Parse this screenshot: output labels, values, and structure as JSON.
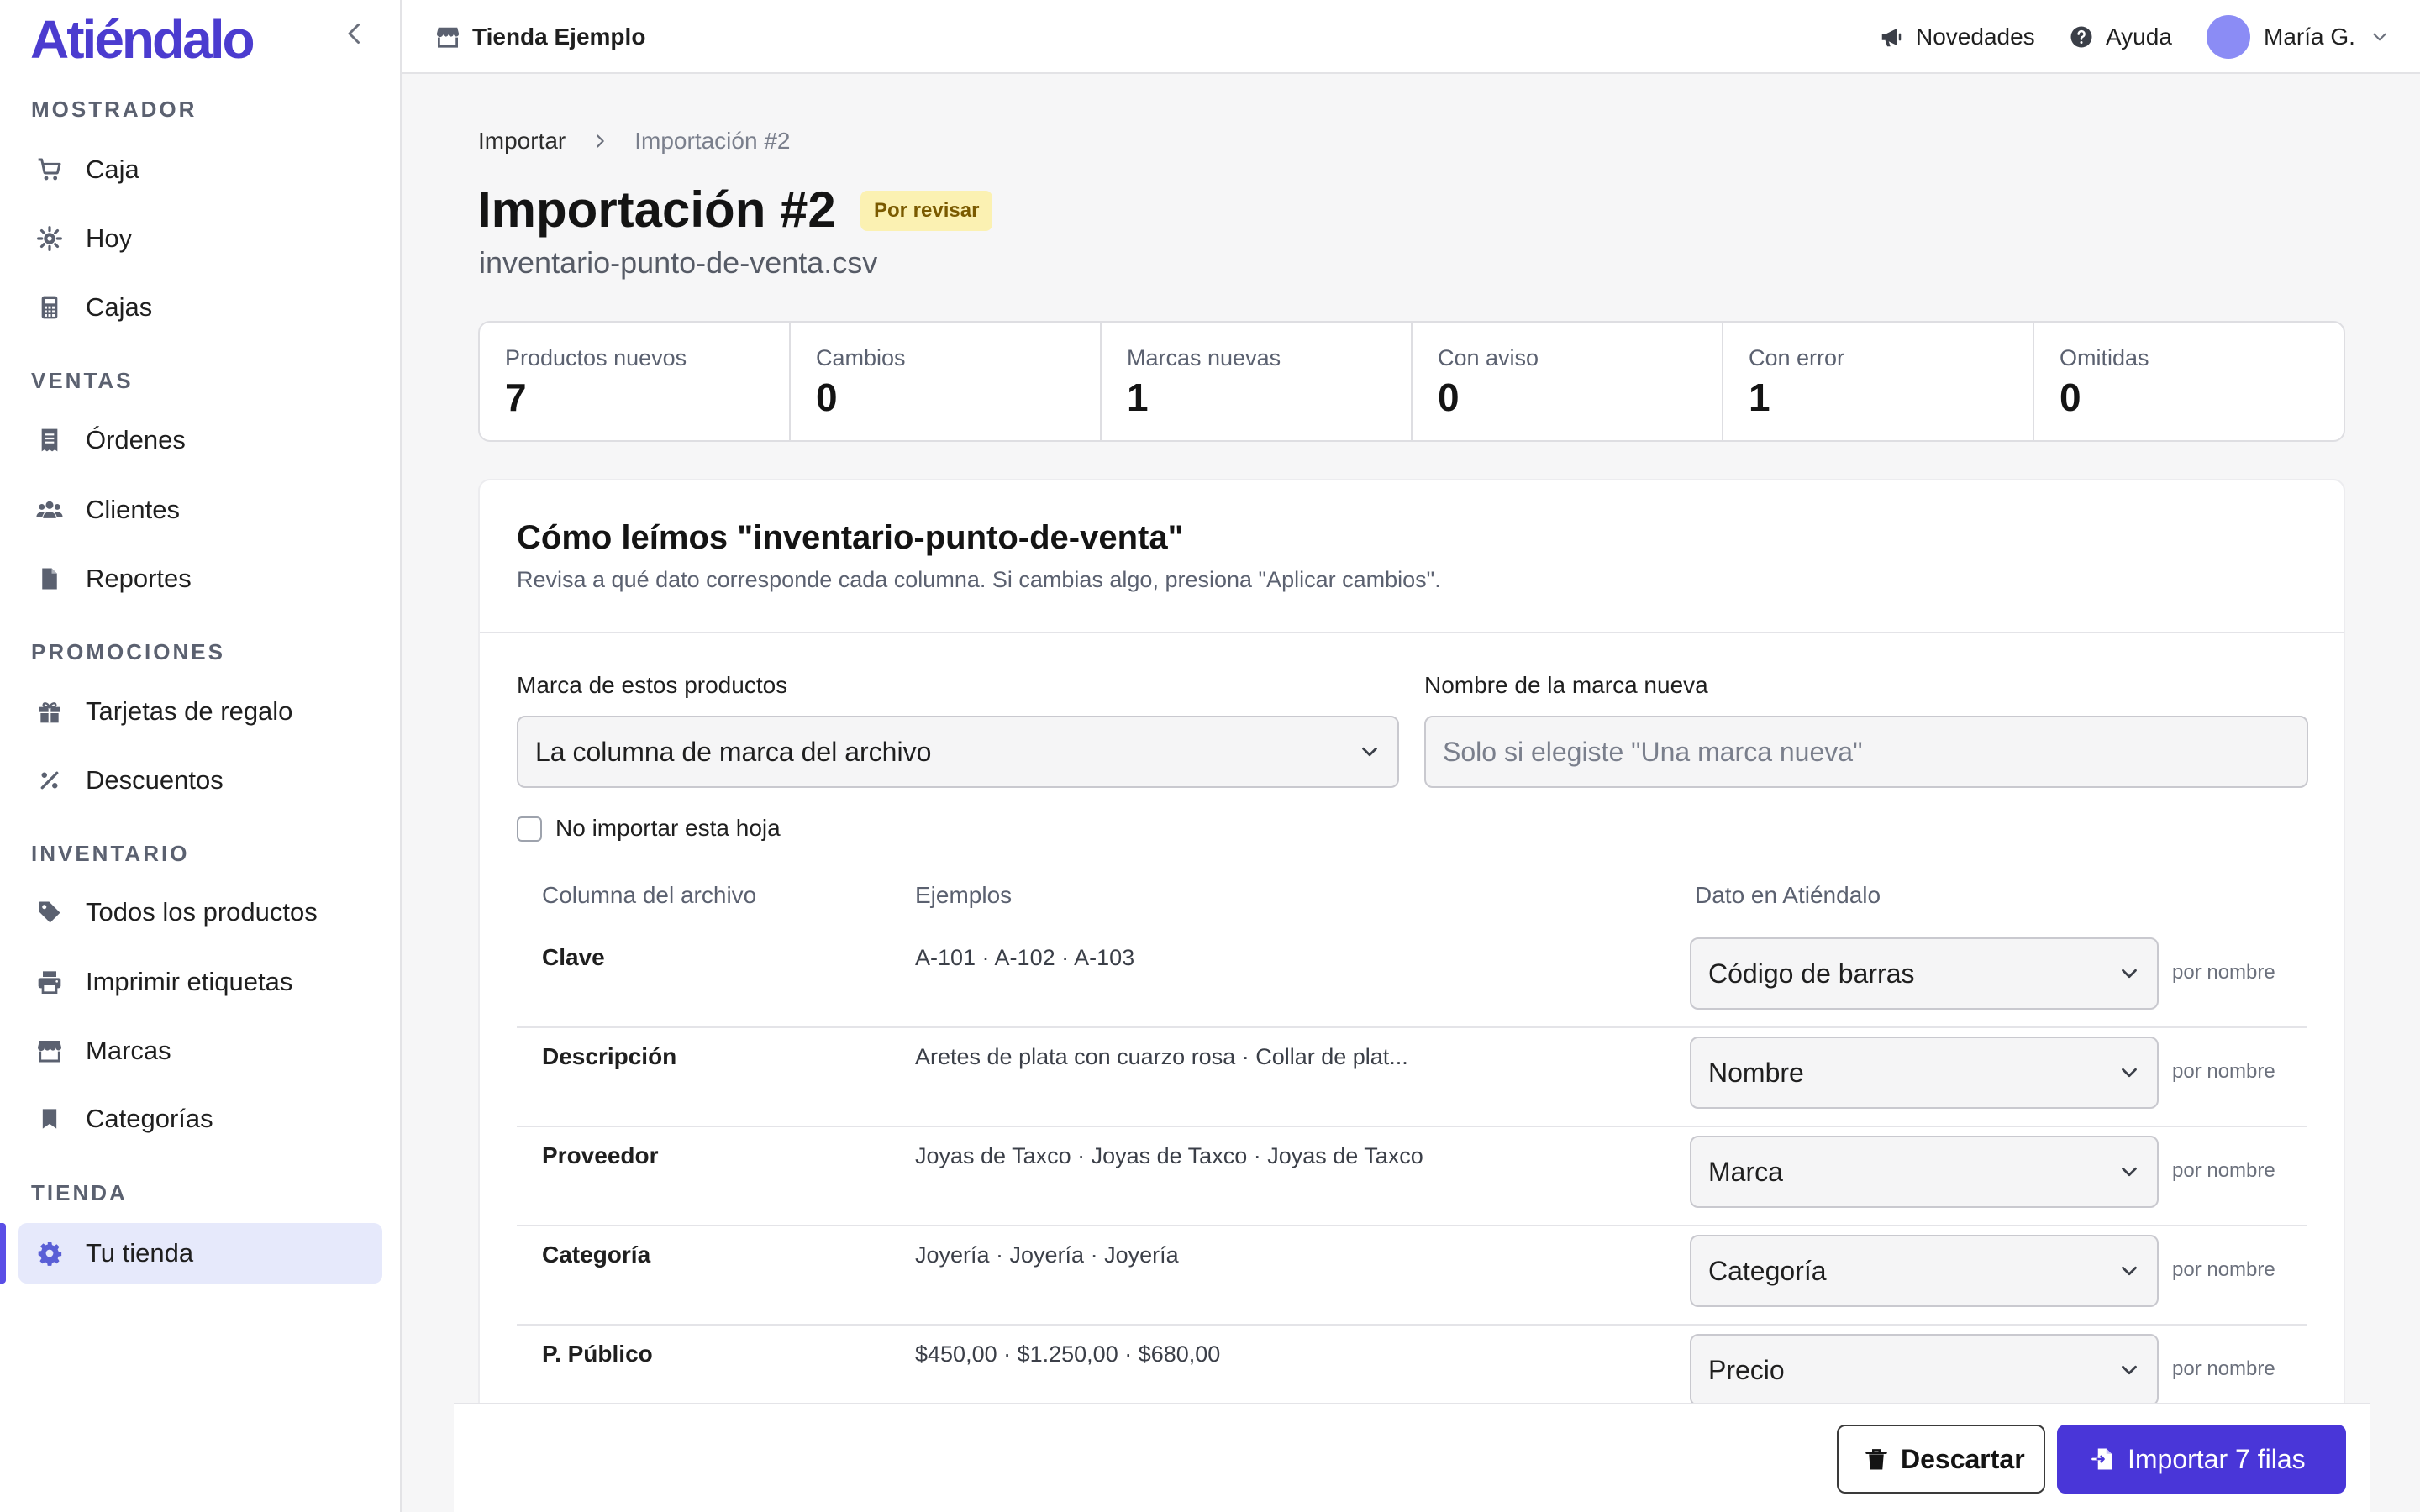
{
  "app": {
    "logo": "Atiéndalo"
  },
  "sidebar": {
    "sections": [
      {
        "title": "MOSTRADOR",
        "items": [
          {
            "label": "Caja",
            "icon": "cart-icon"
          },
          {
            "label": "Hoy",
            "icon": "sun-gear-icon"
          },
          {
            "label": "Cajas",
            "icon": "calculator-icon"
          }
        ]
      },
      {
        "title": "VENTAS",
        "items": [
          {
            "label": "Órdenes",
            "icon": "receipt-icon"
          },
          {
            "label": "Clientes",
            "icon": "users-icon"
          },
          {
            "label": "Reportes",
            "icon": "document-icon"
          }
        ]
      },
      {
        "title": "PROMOCIONES",
        "items": [
          {
            "label": "Tarjetas de regalo",
            "icon": "gift-icon"
          },
          {
            "label": "Descuentos",
            "icon": "percent-icon"
          }
        ]
      },
      {
        "title": "INVENTARIO",
        "items": [
          {
            "label": "Todos los productos",
            "icon": "tag-icon"
          },
          {
            "label": "Imprimir etiquetas",
            "icon": "printer-icon"
          },
          {
            "label": "Marcas",
            "icon": "storefront-icon"
          },
          {
            "label": "Categorías",
            "icon": "bookmark-icon"
          }
        ]
      },
      {
        "title": "TIENDA",
        "items": [
          {
            "label": "Tu tienda",
            "icon": "gear-icon",
            "active": true
          }
        ]
      }
    ]
  },
  "topbar": {
    "store": "Tienda Ejemplo",
    "news": "Novedades",
    "help": "Ayuda",
    "user": "María G."
  },
  "breadcrumb": {
    "parent": "Importar",
    "current": "Importación #2"
  },
  "page": {
    "title": "Importación #2",
    "status": "Por revisar",
    "file": "inventario-punto-de-venta.csv"
  },
  "stats": [
    {
      "label": "Productos nuevos",
      "value": "7"
    },
    {
      "label": "Cambios",
      "value": "0"
    },
    {
      "label": "Marcas nuevas",
      "value": "1"
    },
    {
      "label": "Con aviso",
      "value": "0"
    },
    {
      "label": "Con error",
      "value": "1"
    },
    {
      "label": "Omitidas",
      "value": "0"
    }
  ],
  "mapping": {
    "title": "Cómo leímos \"inventario-punto-de-venta\"",
    "subtitle": "Revisa a qué dato corresponde cada columna. Si cambias algo, presiona \"Aplicar cambios\".",
    "brand_label": "Marca de estos productos",
    "brand_value": "La columna de marca del archivo",
    "new_brand_label": "Nombre de la marca nueva",
    "new_brand_placeholder": "Solo si elegiste \"Una marca nueva\"",
    "skip_sheet": "No importar esta hoja",
    "headers": {
      "column": "Columna del archivo",
      "examples": "Ejemplos",
      "field": "Dato en Atiéndalo"
    },
    "rows": [
      {
        "column": "Clave",
        "examples": "A-101 · A-102 · A-103",
        "field": "Código de barras",
        "by": "por nombre"
      },
      {
        "column": "Descripción",
        "examples": "Aretes de plata con cuarzo rosa · Collar de plat...",
        "field": "Nombre",
        "by": "por nombre"
      },
      {
        "column": "Proveedor",
        "examples": "Joyas de Taxco · Joyas de Taxco · Joyas de Taxco",
        "field": "Marca",
        "by": "por nombre"
      },
      {
        "column": "Categoría",
        "examples": "Joyería · Joyería · Joyería",
        "field": "Categoría",
        "by": "por nombre"
      },
      {
        "column": "P. Público",
        "examples": "$450,00 · $1.250,00 · $680,00",
        "field": "Precio",
        "by": "por nombre"
      }
    ]
  },
  "footer": {
    "discard": "Descartar",
    "import": "Importar 7 filas"
  },
  "colors": {
    "accent": "#4936d8",
    "logo": "#4b3ccf",
    "badge_bg": "#fbf1b2",
    "active_nav": "#e6e9fb"
  }
}
